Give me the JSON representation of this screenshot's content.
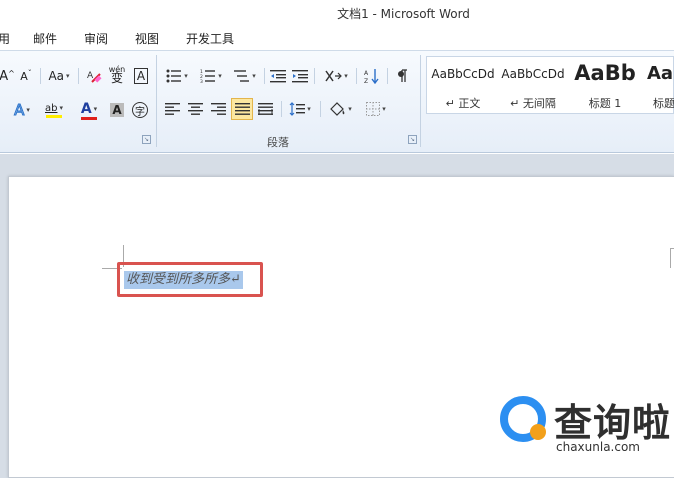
{
  "window": {
    "title": "文档1  -  Microsoft Word"
  },
  "menu": {
    "tabs": [
      "用",
      "邮件",
      "审阅",
      "视图",
      "开发工具"
    ]
  },
  "font_group": {
    "grow_label": "A",
    "shrink_label": "A",
    "case_label": "Aa",
    "pinyin_label": "wén",
    "phonetic_char": "变",
    "border_char_label": "A",
    "text_effect_label": "A",
    "highlight_label": "ab",
    "font_color_label": "A",
    "char_shading_label": "A",
    "enclose_label": "字",
    "launcher": "↘"
  },
  "paragraph_group": {
    "label": "段落",
    "launcher": "↘"
  },
  "styles": {
    "items": [
      {
        "preview": "AaBbCcDd",
        "name": "↵ 正文"
      },
      {
        "preview": "AaBbCcDd",
        "name": "↵ 无间隔"
      },
      {
        "preview": "AaBb",
        "name": "标题 1"
      },
      {
        "preview": "AaB",
        "name": "标题"
      }
    ]
  },
  "document": {
    "selected_text": "收到受到所多所多↵"
  },
  "watermark": {
    "name": "查询啦",
    "url": "chaxunla.com"
  },
  "colors": {
    "accent": "#2c8ff1",
    "selection": "#a9c8ec",
    "highlight_box": "#d9534f",
    "font_color_bar": "#e0201b",
    "highlight_bar": "#ffee00"
  }
}
